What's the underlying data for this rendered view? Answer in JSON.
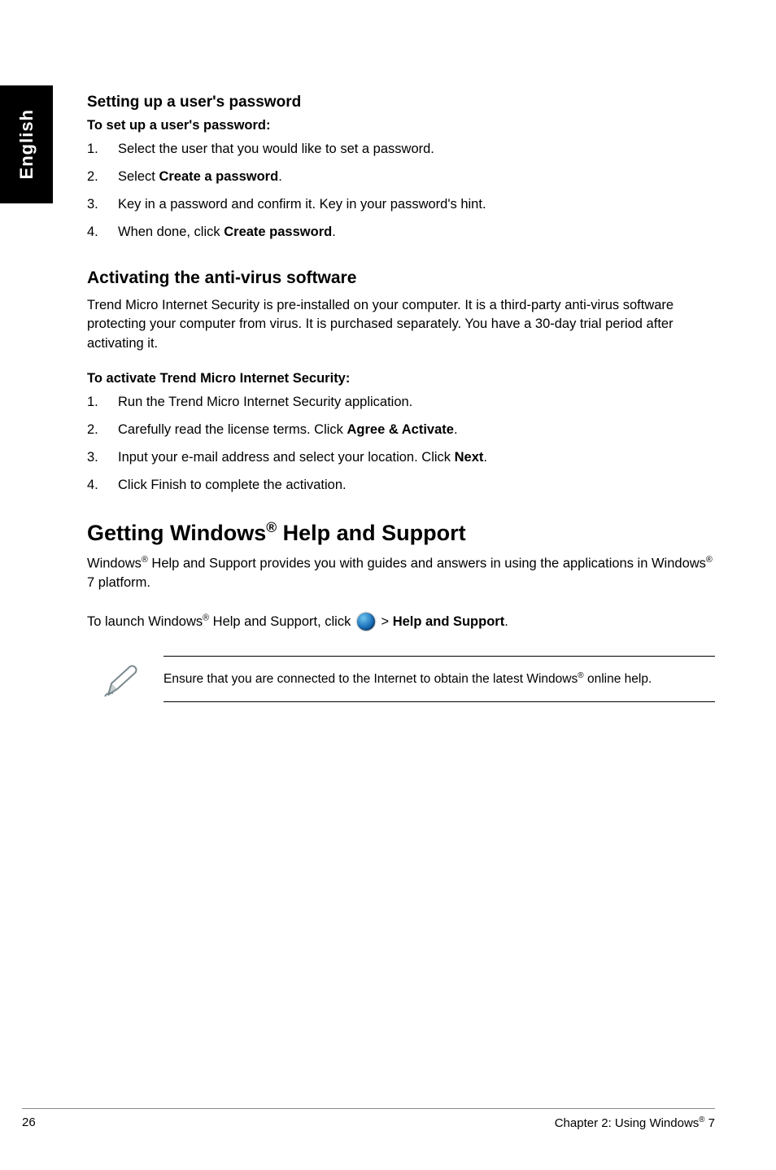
{
  "sidebar": {
    "language": "English"
  },
  "section1": {
    "heading": "Setting up a user's password",
    "subheading": "To set up a user's password:",
    "steps": [
      {
        "num": "1.",
        "text": "Select the user that you would like to set a password."
      },
      {
        "num": "2.",
        "pre": "Select ",
        "bold": "Create a password",
        "post": "."
      },
      {
        "num": "3.",
        "text": "Key in a password and confirm it. Key in your password's hint."
      },
      {
        "num": "4.",
        "pre": "When done, click ",
        "bold": "Create password",
        "post": "."
      }
    ]
  },
  "section2": {
    "heading": "Activating the anti-virus software",
    "intro": "Trend Micro Internet Security is pre-installed on your computer. It is a third-party anti-virus software protecting your computer from virus. It is purchased separately. You have a 30-day trial period after activating it.",
    "subheading": "To activate Trend Micro Internet Security:",
    "steps": [
      {
        "num": "1.",
        "text": "Run the Trend Micro Internet Security application."
      },
      {
        "num": "2.",
        "pre": "Carefully read the license terms. Click ",
        "bold": "Agree & Activate",
        "post": "."
      },
      {
        "num": "3.",
        "pre": "Input your e-mail address and select your location. Click ",
        "bold": "Next",
        "post": "."
      },
      {
        "num": "4.",
        "text": "Click Finish to complete the activation."
      }
    ]
  },
  "section3": {
    "heading_pre": "Getting Windows",
    "heading_sup": "®",
    "heading_post": " Help and Support",
    "intro_pre": "Windows",
    "intro_sup1": "®",
    "intro_mid": " Help and Support provides you with guides and answers in using the applications in Windows",
    "intro_sup2": "®",
    "intro_post": " 7 platform.",
    "launch_pre": "To launch Windows",
    "launch_sup": "®",
    "launch_mid": " Help and Support, click ",
    "launch_gt": " > ",
    "launch_bold": "Help and Support",
    "launch_post": ".",
    "note_pre": "Ensure that you are connected to the Internet to obtain the latest Windows",
    "note_sup": "®",
    "note_post": " online help."
  },
  "footer": {
    "page": "26",
    "chapter_pre": "Chapter 2: Using Windows",
    "chapter_sup": "®",
    "chapter_post": " 7"
  }
}
